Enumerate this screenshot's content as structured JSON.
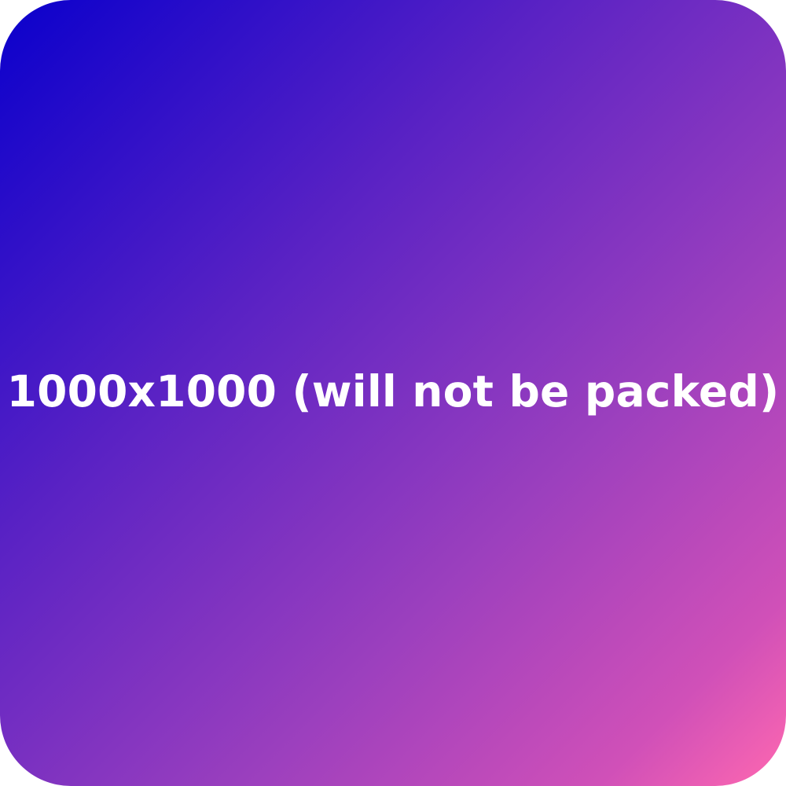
{
  "caption": "1000x1000 (will not be packed)",
  "colors": {
    "gradient_start": "#0a00cc",
    "gradient_end": "#ff68b0",
    "text": "#ffffff"
  }
}
